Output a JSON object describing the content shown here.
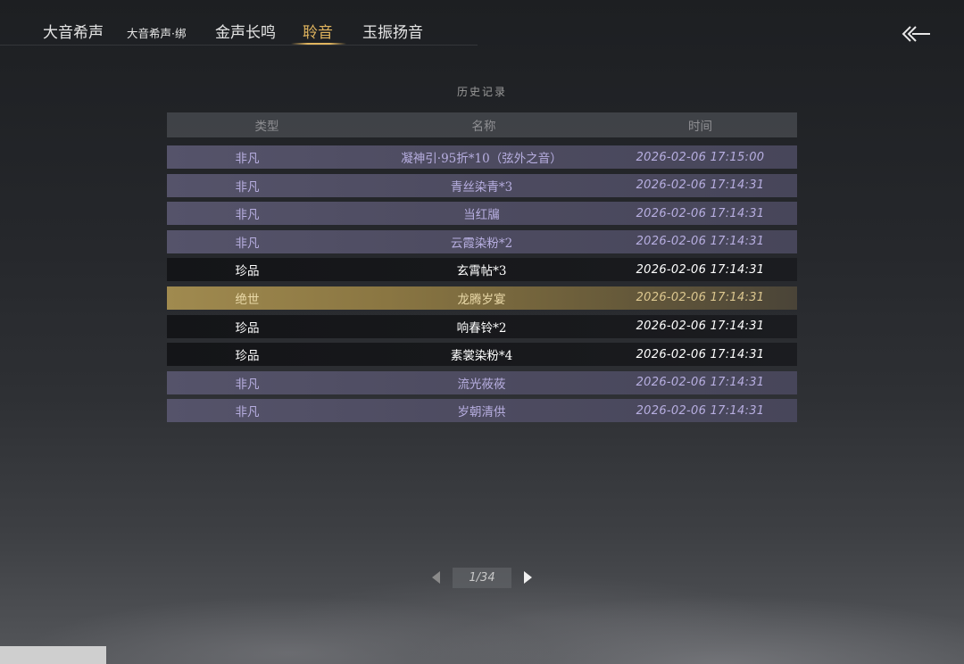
{
  "nav": {
    "tabs": [
      {
        "label": "大音希声",
        "active": false
      },
      {
        "label": "大音希声·绑",
        "active": false
      },
      {
        "label": "金声长鸣",
        "active": false
      },
      {
        "label": "聆音",
        "active": true
      },
      {
        "label": "玉振扬音",
        "active": false
      }
    ],
    "back_icon": "back-arrow-icon"
  },
  "panel": {
    "title": "历史记录"
  },
  "table": {
    "headers": {
      "type": "类型",
      "name": "名称",
      "time": "时间"
    },
    "rows": [
      {
        "type": "非凡",
        "name": "凝神引·95折*10（弦外之音）",
        "time": "2026-02-06 17:15:00",
        "tier": "fanfan"
      },
      {
        "type": "非凡",
        "name": "青丝染青*3",
        "time": "2026-02-06 17:14:31",
        "tier": "fanfan"
      },
      {
        "type": "非凡",
        "name": "当红牖",
        "time": "2026-02-06 17:14:31",
        "tier": "fanfan"
      },
      {
        "type": "非凡",
        "name": "云霞染粉*2",
        "time": "2026-02-06 17:14:31",
        "tier": "fanfan"
      },
      {
        "type": "珍品",
        "name": "玄霄帖*3",
        "time": "2026-02-06 17:14:31",
        "tier": "zhenpin"
      },
      {
        "type": "绝世",
        "name": "龙腾岁宴",
        "time": "2026-02-06 17:14:31",
        "tier": "jueshi"
      },
      {
        "type": "珍品",
        "name": "响春铃*2",
        "time": "2026-02-06 17:14:31",
        "tier": "zhenpin"
      },
      {
        "type": "珍品",
        "name": "素裳染粉*4",
        "time": "2026-02-06 17:14:31",
        "tier": "zhenpin"
      },
      {
        "type": "非凡",
        "name": "流光莜莜",
        "time": "2026-02-06 17:14:31",
        "tier": "fanfan"
      },
      {
        "type": "非凡",
        "name": "岁朝清供",
        "time": "2026-02-06 17:14:31",
        "tier": "fanfan"
      }
    ]
  },
  "pager": {
    "label": "1/34",
    "prev_icon": "triangle-left-icon",
    "next_icon": "triangle-right-icon"
  },
  "colors": {
    "accent_gold": "#e0b45e",
    "tier_fanfan": "#b7aee0",
    "tier_zhenpin": "#ffffff",
    "tier_jueshi": "#ead9a8"
  }
}
